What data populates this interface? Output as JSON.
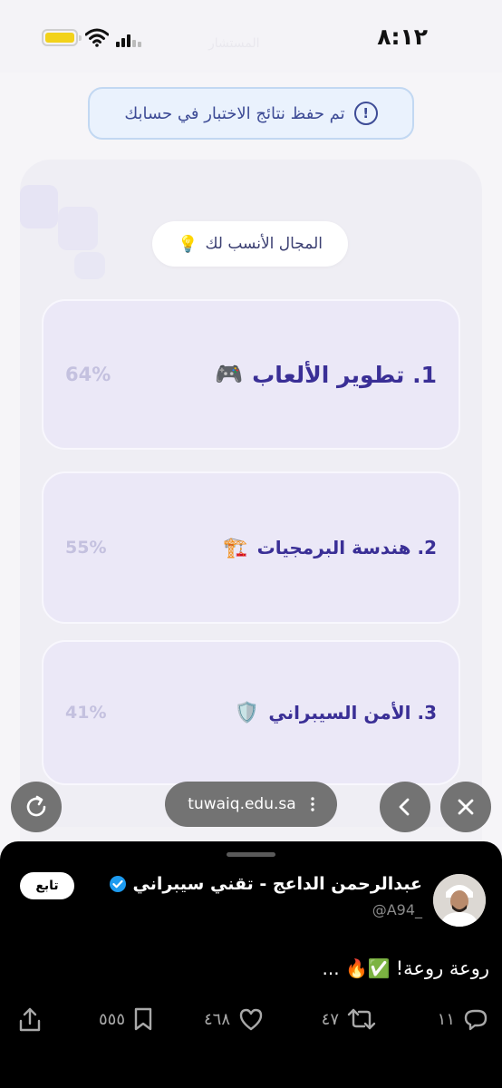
{
  "status_bar": {
    "time": "٨:١٢",
    "faded_title": "المستشار"
  },
  "notice": {
    "text": "تم حفظ نتائج الاختبار في حسابك"
  },
  "result": {
    "best_label": "المجال الأنسب لك",
    "best_emoji": "💡",
    "fields": [
      {
        "name": "1.  تطوير الألعاب",
        "emoji": "🎮",
        "percent": "64%"
      },
      {
        "name": "2. هندسة البرمجيات",
        "emoji": "🏗️",
        "percent": "55%"
      },
      {
        "name": "3. الأمن السيبراني",
        "emoji": "🛡️",
        "percent": "41%"
      }
    ]
  },
  "browser": {
    "url": "tuwaiq.edu.sa"
  },
  "tweet": {
    "author": "عبدالرحمن الداعج - تقني سيبراني",
    "handle": "@A94_",
    "follow_label": "تابع",
    "text": "روعة روعة!",
    "text_emojis": "✅🔥 ...",
    "replies": "١١",
    "retweets": "٤٧",
    "likes": "٤٦٨",
    "views": "٥٥٥"
  },
  "colors": {
    "accent": "#3a2f96",
    "notice_text": "#3e4c96",
    "verified": "#1d9bf0"
  },
  "icons": [
    "wifi-icon",
    "signal-icon",
    "battery-icon",
    "info-icon",
    "reload-icon",
    "back-icon",
    "close-icon",
    "more-icon",
    "verified-icon",
    "reply-icon",
    "retweet-icon",
    "like-icon",
    "bookmark-icon",
    "share-icon"
  ]
}
